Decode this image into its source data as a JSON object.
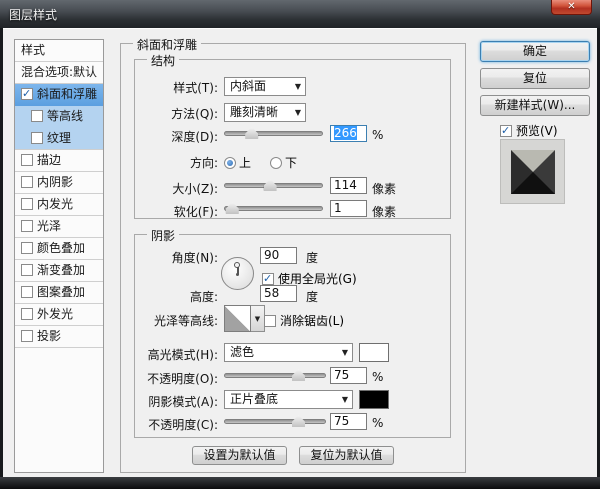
{
  "window": {
    "title": "图层样式",
    "close_glyph": "✕"
  },
  "sidebar": {
    "header": "样式",
    "blending": "混合选项:默认",
    "items": [
      {
        "label": "斜面和浮雕",
        "checked": true,
        "selected": true
      },
      {
        "label": "等高线",
        "checked": false,
        "highlight": true
      },
      {
        "label": "纹理",
        "checked": false,
        "highlight": true
      },
      {
        "label": "描边",
        "checked": false
      },
      {
        "label": "内阴影",
        "checked": false
      },
      {
        "label": "内发光",
        "checked": false
      },
      {
        "label": "光泽",
        "checked": false
      },
      {
        "label": "颜色叠加",
        "checked": false
      },
      {
        "label": "渐变叠加",
        "checked": false
      },
      {
        "label": "图案叠加",
        "checked": false
      },
      {
        "label": "外发光",
        "checked": false
      },
      {
        "label": "投影",
        "checked": false
      }
    ]
  },
  "panel": {
    "title": "斜面和浮雕",
    "structure": {
      "title": "结构",
      "style_label": "样式(T):",
      "style_value": "内斜面",
      "technique_label": "方法(Q):",
      "technique_value": "雕刻清晰",
      "depth_label": "深度(D):",
      "depth_value": "266",
      "depth_unit": "%",
      "direction_label": "方向:",
      "direction_up": "上",
      "direction_down": "下",
      "size_label": "大小(Z):",
      "size_value": "114",
      "size_unit": "像素",
      "soften_label": "软化(F):",
      "soften_value": "1",
      "soften_unit": "像素"
    },
    "shading": {
      "title": "阴影",
      "angle_label": "角度(N):",
      "angle_value": "90",
      "angle_unit": "度",
      "global_light_label": "使用全局光(G)",
      "altitude_label": "高度:",
      "altitude_value": "58",
      "altitude_unit": "度",
      "gloss_contour_label": "光泽等高线:",
      "antialias_label": "消除锯齿(L)",
      "highlight_mode_label": "高光模式(H):",
      "highlight_mode_value": "滤色",
      "highlight_opacity_label": "不透明度(O):",
      "highlight_opacity_value": "75",
      "highlight_opacity_unit": "%",
      "shadow_mode_label": "阴影模式(A):",
      "shadow_mode_value": "正片叠底",
      "shadow_opacity_label": "不透明度(C):",
      "shadow_opacity_value": "75",
      "shadow_opacity_unit": "%"
    },
    "make_default_label": "设置为默认值",
    "reset_default_label": "复位为默认值"
  },
  "actions": {
    "ok": "确定",
    "reset": "复位",
    "new_style": "新建样式(W)...",
    "preview": "预览(V)"
  },
  "colors": {
    "highlight_swatch": "#ffffff",
    "shadow_swatch": "#000000",
    "selection_blue": "#3399ff",
    "sidebar_selected": "#5b9fe0",
    "sidebar_highlight": "#b4d3f0"
  },
  "sliders": {
    "depth_pct": 27,
    "size_pct": 46,
    "soften_pct": 7,
    "highlight_opacity_pct": 73,
    "shadow_opacity_pct": 73
  }
}
